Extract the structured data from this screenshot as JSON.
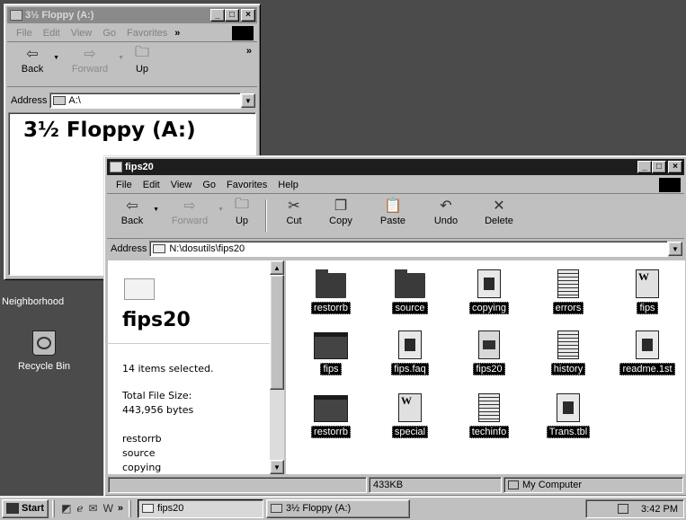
{
  "floppy_window": {
    "title": "3½ Floppy (A:)",
    "menu": [
      "File",
      "Edit",
      "View",
      "Go",
      "Favorites"
    ],
    "menu_more": "»",
    "toolbar_more": "»",
    "toolbar": {
      "back": "Back",
      "forward": "Forward",
      "up": "Up"
    },
    "address_label": "Address",
    "address_value": "A:\\",
    "heading": "3½ Floppy (A:)"
  },
  "fips_window": {
    "title": "fips20",
    "menu": [
      "File",
      "Edit",
      "View",
      "Go",
      "Favorites",
      "Help"
    ],
    "toolbar": {
      "back": "Back",
      "forward": "Forward",
      "up": "Up",
      "cut": "Cut",
      "copy": "Copy",
      "paste": "Paste",
      "undo": "Undo",
      "delete": "Delete"
    },
    "address_label": "Address",
    "address_value": "N:\\dosutils\\fips20",
    "side_panel": {
      "folder_name": "fips20",
      "selection_text": "14 items selected.",
      "total_label": "Total File Size:",
      "total_value": "443,956 bytes",
      "selected_names": [
        "restorrb",
        "source",
        "copying"
      ]
    },
    "files": [
      {
        "name": "restorrb",
        "icon": "folder-icon"
      },
      {
        "name": "source",
        "icon": "folder-icon"
      },
      {
        "name": "copying",
        "icon": "document-icon"
      },
      {
        "name": "errors",
        "icon": "text-file-icon"
      },
      {
        "name": "fips",
        "icon": "word-document-icon"
      },
      {
        "name": "fips",
        "icon": "application-icon"
      },
      {
        "name": "fips.faq",
        "icon": "document-icon"
      },
      {
        "name": "fips20",
        "icon": "dos-program-icon"
      },
      {
        "name": "history",
        "icon": "text-file-icon"
      },
      {
        "name": "readme.1st",
        "icon": "document-icon"
      },
      {
        "name": "restorrb",
        "icon": "application-icon"
      },
      {
        "name": "special",
        "icon": "word-document-icon"
      },
      {
        "name": "techinfo",
        "icon": "text-file-icon"
      },
      {
        "name": "Trans.tbl",
        "icon": "document-icon"
      }
    ],
    "status": {
      "size": "433KB",
      "zone": "My Computer"
    }
  },
  "desktop": {
    "neighborhood_label": "Neighborhood",
    "recycle_bin_label": "Recycle Bin"
  },
  "taskbar": {
    "start_label": "Start",
    "quicklaunch_more": "»",
    "tasks": [
      "fips20",
      "3½ Floppy (A:)"
    ],
    "clock": "3:42 PM"
  }
}
